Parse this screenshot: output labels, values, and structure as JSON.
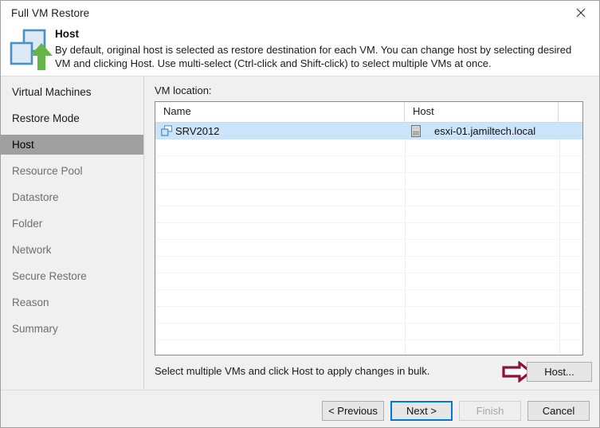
{
  "window": {
    "title": "Full VM Restore",
    "close_icon": "close-icon"
  },
  "header": {
    "icon": "vm-restore-upload-icon",
    "title": "Host",
    "description": "By default, original host is selected as restore destination for each VM. You can change host by selecting desired VM and clicking Host. Use multi-select (Ctrl-click and Shift-click) to select multiple VMs at once."
  },
  "sidebar": {
    "items": [
      {
        "label": "Virtual Machines",
        "state": "done"
      },
      {
        "label": "Restore Mode",
        "state": "done"
      },
      {
        "label": "Host",
        "state": "active"
      },
      {
        "label": "Resource Pool",
        "state": "pending"
      },
      {
        "label": "Datastore",
        "state": "pending"
      },
      {
        "label": "Folder",
        "state": "pending"
      },
      {
        "label": "Network",
        "state": "pending"
      },
      {
        "label": "Secure Restore",
        "state": "pending"
      },
      {
        "label": "Reason",
        "state": "pending"
      },
      {
        "label": "Summary",
        "state": "pending"
      }
    ]
  },
  "main": {
    "section_label": "VM location:",
    "table": {
      "columns": [
        "Name",
        "Host",
        ""
      ],
      "rows": [
        {
          "name": "SRV2012",
          "name_icon": "virtual-machine-icon",
          "host": "esxi-01.jamiltech.local",
          "host_icon": "esxi-host-server-icon",
          "selected": true
        }
      ],
      "empty_row_count": 13
    },
    "bulk_hint": "Select multiple VMs and click Host to apply changes in bulk.",
    "host_button": "Host...",
    "annotation_arrow": "right-arrow-annotation"
  },
  "footer": {
    "previous": "< Previous",
    "next": "Next >",
    "finish": "Finish",
    "cancel": "Cancel"
  },
  "colors": {
    "selection_blue": "#cce4fa",
    "focus_blue": "#0078d7",
    "sidebar_active": "#a0a0a0",
    "annotation_red": "#8c1432",
    "icon_blue": "#5b9bd5",
    "icon_green": "#6fbe44"
  }
}
